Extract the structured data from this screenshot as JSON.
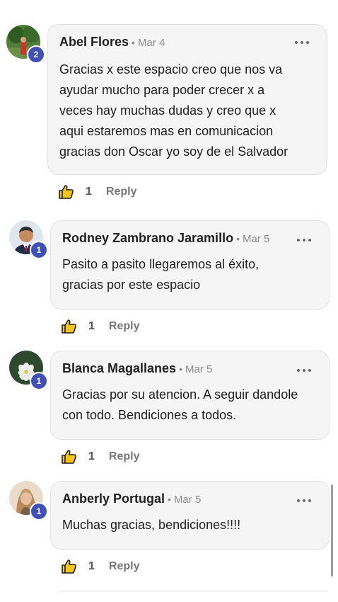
{
  "comments": [
    {
      "author": "Abel Flores",
      "separator": "•",
      "date": "Mar 4",
      "level": "2",
      "lines": [
        "Gracias x este espacio creo que nos va",
        "ayudar mucho para poder crecer x a",
        "veces hay muchas dudas y creo que x",
        "aqui estaremos mas en comunicacion",
        "gracias don Oscar yo soy de el Salvador"
      ],
      "likes": "1",
      "reply_label": "Reply",
      "avatar": "landscape-photo-avatar"
    },
    {
      "author": "Rodney Zambrano Jaramillo",
      "separator": "•",
      "date": "Mar 5",
      "level": "1",
      "lines": [
        "Pasito a pasito llegaremos al éxito,",
        "gracias por este espacio"
      ],
      "likes": "1",
      "reply_label": "Reply",
      "avatar": "man-in-suit-photo-avatar"
    },
    {
      "author": "Blanca Magallanes",
      "separator": "•",
      "date": "Mar 5",
      "level": "1",
      "lines": [
        "Gracias por su atencion. A seguir dandole",
        "con todo. Bendiciones a todos."
      ],
      "likes": "1",
      "reply_label": "Reply",
      "avatar": "lotus-flower-avatar"
    },
    {
      "author": "Anberly Portugal",
      "separator": "•",
      "date": "Mar 5",
      "level": "1",
      "lines": [
        "Muchas gracias, bendiciones!!!!"
      ],
      "likes": "1",
      "reply_label": "Reply",
      "avatar": "woman-photo-avatar"
    }
  ],
  "colors": {
    "bubble_bg": "#f5f5f5",
    "badge": "#3f51b5",
    "muted_text": "#8a8a8a"
  }
}
